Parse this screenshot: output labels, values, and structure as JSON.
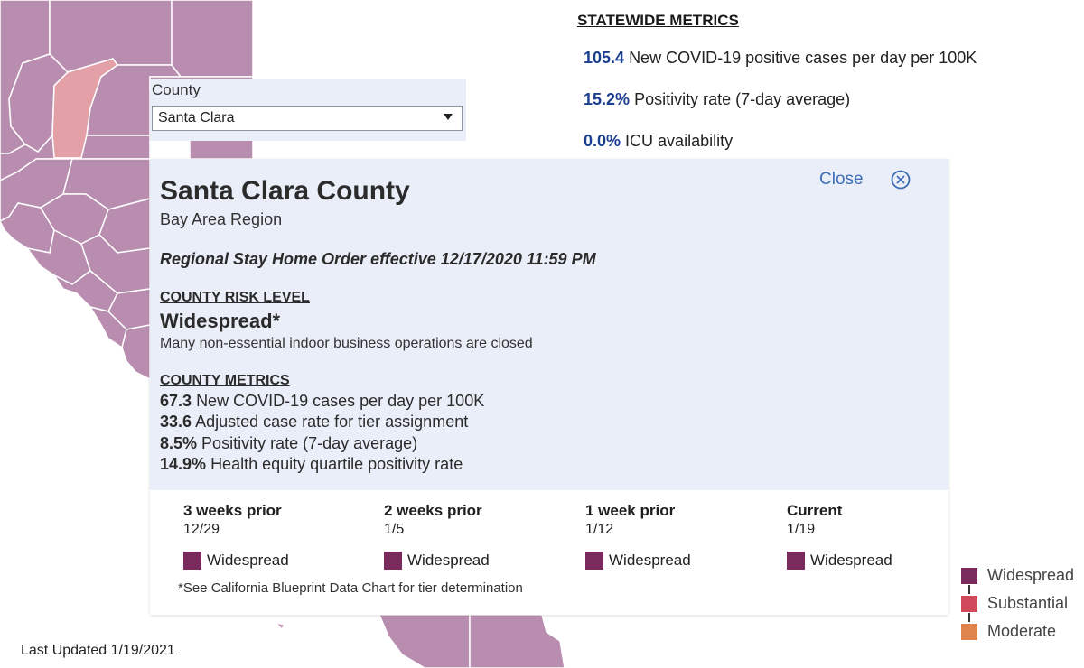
{
  "colors": {
    "widespread": "#7b2a5d",
    "substantial": "#d04a5b",
    "moderate": "#e0844d",
    "map_county": "#b98daf",
    "map_selected": "#e3a0a6",
    "map_border": "#ffffff"
  },
  "county_selector": {
    "label": "County",
    "selected": "Santa Clara"
  },
  "statewide": {
    "title": "STATEWIDE METRICS",
    "metrics": [
      {
        "value": "105.4",
        "label": "New COVID-19 positive cases per day per 100K"
      },
      {
        "value": "15.2%",
        "label": "Positivity rate (7-day average)"
      },
      {
        "value": "0.0%",
        "label": "ICU availability"
      }
    ]
  },
  "panel": {
    "close_label": "Close",
    "close_icon": "circle-x-icon",
    "county_name": "Santa Clara County",
    "region": "Bay Area Region",
    "order": "Regional Stay Home Order effective 12/17/2020 11:59 PM",
    "risk_header": "COUNTY RISK LEVEL",
    "risk_level": "Widespread*",
    "risk_desc": "Many non-essential indoor business operations are closed",
    "metrics_header": "COUNTY METRICS",
    "metrics": [
      {
        "value": "67.3",
        "label": "New COVID-19 cases per day per 100K"
      },
      {
        "value": "33.6",
        "label": "Adjusted case rate for tier assignment"
      },
      {
        "value": "8.5%",
        "label": "Positivity rate (7-day average)"
      },
      {
        "value": "14.9%",
        "label": "Health equity quartile positivity rate"
      }
    ],
    "history": [
      {
        "label": "3 weeks prior",
        "date": "12/29",
        "tier": "Widespread"
      },
      {
        "label": "2 weeks prior",
        "date": "1/5",
        "tier": "Widespread"
      },
      {
        "label": "1 week prior",
        "date": "1/12",
        "tier": "Widespread"
      },
      {
        "label": "Current",
        "date": "1/19",
        "tier": "Widespread"
      }
    ],
    "footnote": "*See California Blueprint Data Chart for tier determination"
  },
  "last_updated": "Last Updated 1/19/2021",
  "legend": [
    {
      "label": "Widespread",
      "color": "#7b2a5d"
    },
    {
      "label": "Substantial",
      "color": "#d04a5b"
    },
    {
      "label": "Moderate",
      "color": "#e0844d"
    }
  ]
}
